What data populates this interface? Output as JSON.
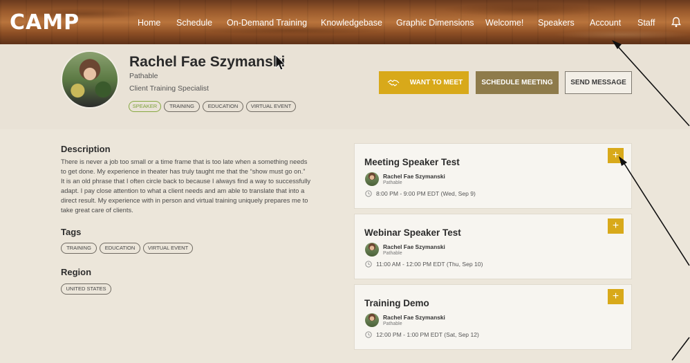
{
  "app": {
    "logo_text": "CAMP"
  },
  "nav": {
    "items": [
      {
        "label": "Home",
        "name": "nav-home"
      },
      {
        "label": "Schedule",
        "name": "nav-schedule"
      },
      {
        "label": "On-Demand Training",
        "name": "nav-on-demand-training"
      },
      {
        "label": "Knowledgebase",
        "name": "nav-knowledgebase"
      },
      {
        "label": "Graphic Dimensions",
        "name": "nav-graphic-dimensions"
      },
      {
        "label": "Welcome!",
        "name": "nav-welcome"
      },
      {
        "label": "Speakers",
        "name": "nav-speakers"
      },
      {
        "label": "Account",
        "name": "nav-account"
      },
      {
        "label": "Staff",
        "name": "nav-staff"
      }
    ],
    "bell_icon": "bell-icon"
  },
  "profile": {
    "name": "Rachel Fae Szymanski",
    "organization": "Pathable",
    "title": "Client Training Specialist",
    "chips": [
      "SPEAKER",
      "TRAINING",
      "EDUCATION",
      "VIRTUAL EVENT"
    ],
    "buttons": {
      "want_to_meet": "WANT TO MEET",
      "schedule_meeting": "SCHEDULE MEETING",
      "send_message": "SEND MESSAGE"
    }
  },
  "details": {
    "description_heading": "Description",
    "description_lines": [
      "There is never a job too small or a time frame that is too late when a something needs",
      "to get done. My experience in theater has truly taught me that the “show must go on.”",
      "It is an old phrase that I often circle back to because I always find a way to successfully",
      "adapt. I pay close attention to what a client needs and am able to translate that into a",
      "direct result. My experience with in person and virtual training uniquely prepares me to",
      "take great care of clients."
    ],
    "tags_heading": "Tags",
    "tags": [
      "TRAINING",
      "EDUCATION",
      "VIRTUAL EVENT"
    ],
    "region_heading": "Region",
    "region": [
      "UNITED STATES"
    ]
  },
  "sessions": [
    {
      "title": "Meeting Speaker Test",
      "speaker": "Rachel Fae Szymanski",
      "org": "Pathable",
      "time": "8:00 PM - 9:00 PM EDT (Wed, Sep 9)",
      "add": "+"
    },
    {
      "title": "Webinar Speaker Test",
      "speaker": "Rachel Fae Szymanski",
      "org": "Pathable",
      "time": "11:00 AM - 12:00 PM EDT (Thu, Sep 10)",
      "add": "+"
    },
    {
      "title": "Training Demo",
      "speaker": "Rachel Fae Szymanski",
      "org": "Pathable",
      "time": "12:00 PM - 1:00 PM EDT (Sat, Sep 12)",
      "add": "+"
    }
  ],
  "colors": {
    "accent": "#d8a91a",
    "schedule_button": "#8e7b4b",
    "chip_green": "#7ca03a"
  }
}
